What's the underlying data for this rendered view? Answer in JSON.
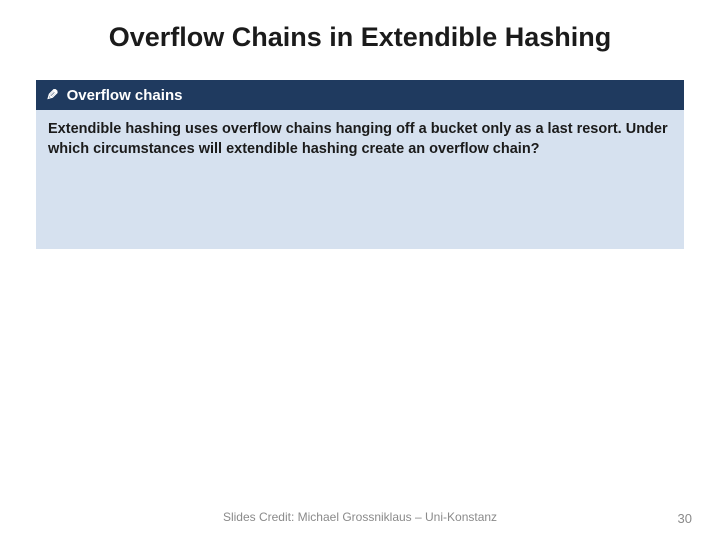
{
  "slide": {
    "title": "Overflow Chains in Extendible Hashing",
    "callout": {
      "icon": "✎",
      "heading": "Overflow chains",
      "body": "Extendible hashing uses overflow chains hanging off a bucket only as a last resort. Under which circumstances will extendible hashing create an overflow chain?"
    },
    "footer_credit": "Slides Credit: Michael Grossniklaus – Uni-Konstanz",
    "page_number": "30"
  }
}
